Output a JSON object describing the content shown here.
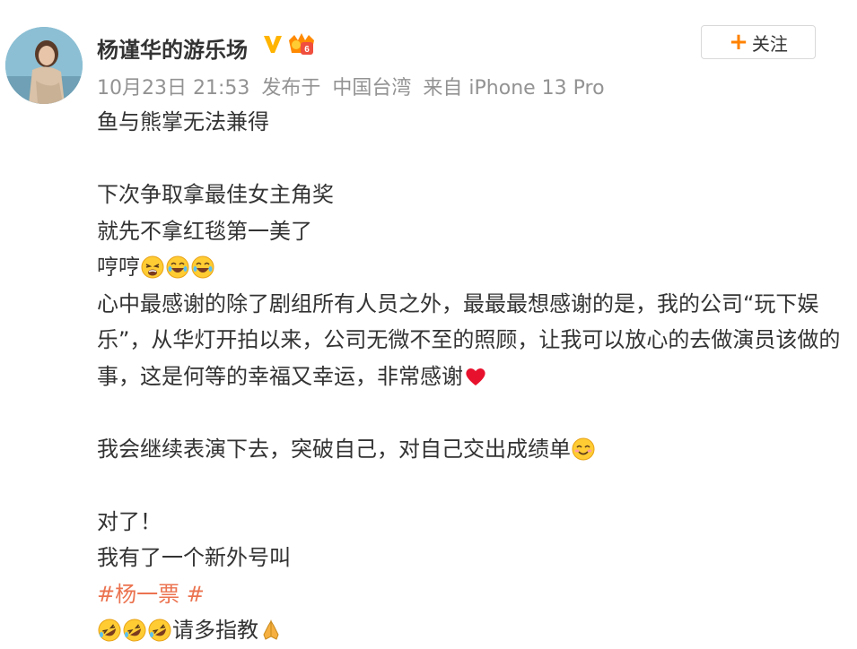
{
  "user": {
    "name": "杨谨华的游乐场",
    "verified_icon": "verified-v-icon",
    "vip_icon": "vip-crown-icon"
  },
  "meta": {
    "date": "10月23日 21:53",
    "posted_from_prefix": "发布于",
    "location": "中国台湾",
    "source": "来自 iPhone 13 Pro"
  },
  "follow_button": {
    "plus": "+",
    "label": "关注"
  },
  "post": {
    "line1": "鱼与熊掌无法兼得",
    "line2": "下次争取拿最佳女主角奖",
    "line3": "就先不拿红毯第一美了",
    "line4": "哼哼",
    "para1": "心中最感谢的除了剧组所有人员之外，最最最想感谢的是，我的公司“玩下娱乐”，从华灯开拍以来，公司无微不至的照顾，让我可以放心的去做演员该做的事，这是何等的幸福又幸运，非常感谢",
    "line6": "我会继续表演下去，突破自己，对自己交出成绩单",
    "line7": "对了！",
    "line8": "我有了一个新外号叫",
    "hashtag": "#杨一票 #",
    "line10": "请多指教"
  },
  "colors": {
    "text": "#333333",
    "meta": "#939393",
    "hashtag": "#eb7350",
    "accent": "#ff8200"
  }
}
